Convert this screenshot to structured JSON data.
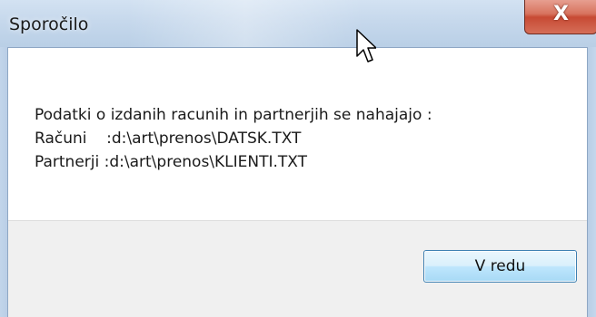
{
  "window": {
    "title": "Sporočilo",
    "close_label": "X"
  },
  "message": {
    "line1": "Podatki o izdanih racunih in partnerjih se nahajajo :",
    "line2": "Računi    :d:\\art\\prenos\\DATSK.TXT",
    "line3": "Partnerji :d:\\art\\prenos\\KLIENTI.TXT"
  },
  "buttons": {
    "ok_label": "V redu"
  },
  "icons": {
    "close": "close-icon",
    "pointer": "mouse-pointer-icon"
  },
  "colors": {
    "titlebar": "#c6d8ec",
    "close_button": "#c74a34",
    "footer": "#f0f0f0",
    "ok_button_border": "#3c7fb1"
  }
}
